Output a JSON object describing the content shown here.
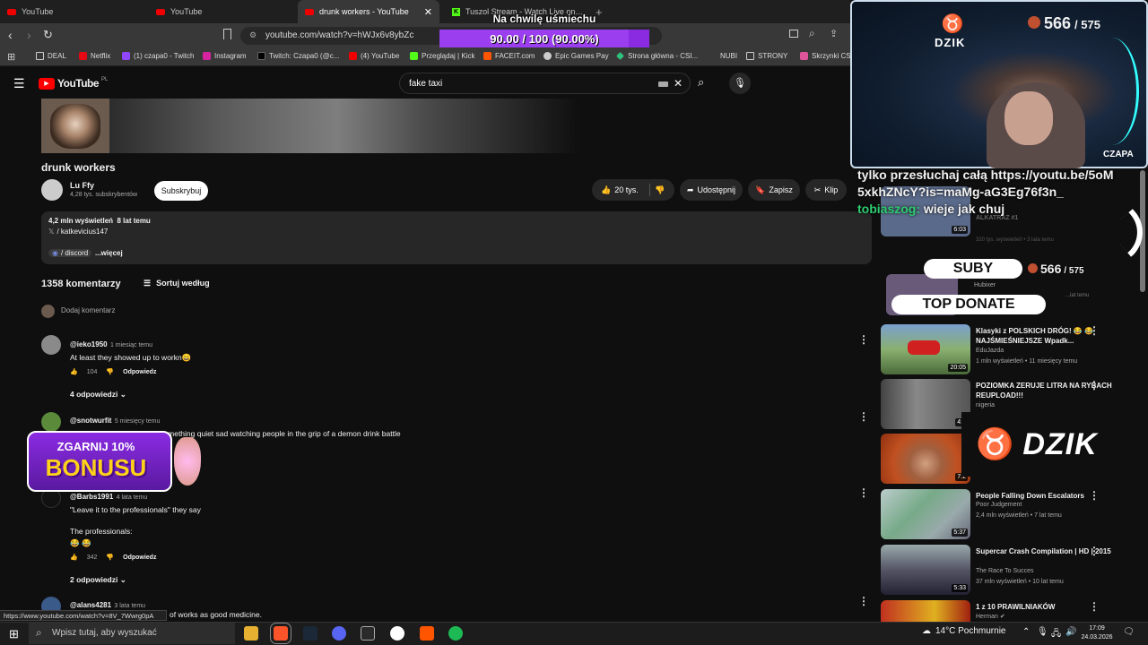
{
  "tabs": [
    {
      "label": "YouTube",
      "type": "yt"
    },
    {
      "label": "YouTube",
      "type": "yt"
    },
    {
      "label": "drunk workers - YouTube",
      "type": "yt",
      "active": true
    },
    {
      "label": "Tuszol Stream - Watch Live on Kick",
      "type": "kick"
    }
  ],
  "browser": {
    "url": "youtube.com/watch?v=hWJx6v8ybZc",
    "status_url": "https://www.youtube.com/watch?v=8V_7Wwrg0pA"
  },
  "bookmarks": [
    "DEAL",
    "Netflix",
    "(1) czapa0 - Twitch",
    "Instagram",
    "Twitch: Czapa0 (@c...",
    "(4) YouTube",
    "Przeglądaj | Kick",
    "FACEIT.com",
    "Epic Games Pay",
    "Strona główna - CSI...",
    "NUBI",
    "STRONY",
    "Skrzynki CSx"
  ],
  "overlay": {
    "goal_title": "Na chwilę uśmiechu",
    "goal_progress": "90.00 / 100 (90.00%)",
    "goal_fraction": 0.9,
    "subs_current": "566",
    "subs_total": "/ 575",
    "cam_brand": "DZIK",
    "cam_name": "CZAPA",
    "subs_label": "SUBY",
    "top_donate_label": "TOP DONATE",
    "promo_line1": "ZGARNIJ 10%",
    "promo_line2": "BONUSU",
    "dzik_banner": "DZIK",
    "chat": [
      {
        "user": "",
        "text": "tylko przesłuchaj całą https://youtu.be/5oM5xkhZNcY?is=maMg-aG3Eg76f3n_"
      },
      {
        "user": "tobiaszog:",
        "text": "wieje jak chuj"
      }
    ]
  },
  "youtube": {
    "logo": "YouTube",
    "region": "PL",
    "search_query": "fake taxi",
    "video_title": "drunk workers",
    "channel_name": "Lu Ffy",
    "channel_subs": "4,28 tys. subskrybentów",
    "subscribe_label": "Subskrybuj",
    "likes": "20 tys.",
    "share_label": "Udostępnij",
    "save_label": "Zapisz",
    "clip_label": "Klip",
    "desc_stats": "4,2 mln wyświetleń  8 lat temu",
    "desc_link1": "/ katkevicius147",
    "desc_link2": "/ discord",
    "desc_more": "...więcej",
    "comment_count": "1358 komentarzy",
    "sort_label": "Sortuj według",
    "add_comment": "Dodaj komentarz",
    "reply_label": "Odpowiedz",
    "comments": [
      {
        "user": "@ieko1950",
        "time": "1 miesiąc temu",
        "text": "At least they showed up to workn😄",
        "likes": "104",
        "replies": "4 odpowiedzi"
      },
      {
        "user": "@snotwurfit",
        "time": "5 miesięcy temu",
        "text": "For all the laughs, there is something quiet sad watching people in the grip of a demon drink battle",
        "likes": "",
        "replies": ""
      },
      {
        "user": "@Barbs1991",
        "time": "4 lata temu",
        "text": "\"Leave it to the professionals\" they say",
        "text2": "The professionals:",
        "text3": "😂 😂",
        "likes": "342",
        "replies": "2 odpowiedzi"
      },
      {
        "user": "@alans4281",
        "time": "3 lata temu",
        "text": "of works as good medicine.",
        "likes": "",
        "replies": ""
      }
    ],
    "recommendations": [
      {
        "title": "Klasyki z POLSKICH DRÓG! 😂 😂 NAJŚMIEŚNIEJSZE Wpadk...",
        "channel": "EduJazda",
        "meta": "1 mln wyświetleń • 11 miesięcy temu",
        "duration": "20:05"
      },
      {
        "title": "POZIOMKA ZERUJE LITRA NA RYBACH REUPLOAD!!!",
        "channel": "nigeria",
        "meta": "",
        "duration": "4:5"
      },
      {
        "title": "",
        "channel": "",
        "meta": "",
        "duration": "7:2"
      },
      {
        "title": "People Falling Down Escalators",
        "channel": "Poor Judgement",
        "meta": "2,4 mln wyświetleń • 7 lat temu",
        "duration": "5:37"
      },
      {
        "title": "Supercar Crash Compilation | HD | 2015",
        "channel": "The Race To Succes",
        "meta": "37 mln wyświetleń • 10 lat temu",
        "duration": "5:33"
      },
      {
        "title": "1 z 10 PRAWILNIAKÓW",
        "channel": "Herman ✔",
        "meta": "",
        "duration": ""
      }
    ],
    "rec_partial": [
      {
        "title": "...ndo Enciero - Toros de la...",
        "duration": "6:03"
      },
      {
        "title": "ALKATRAZ #1",
        "meta": "320 tys. wyświetleń • 3 lata temu"
      },
      {
        "channel": "Hubixer",
        "meta": "...lat temu"
      }
    ]
  },
  "taskbar": {
    "search_placeholder": "Wpisz tutaj, aby wyszukać",
    "weather": "14°C  Pochmurnie",
    "time": "17:09",
    "date": "24.03.2026"
  }
}
